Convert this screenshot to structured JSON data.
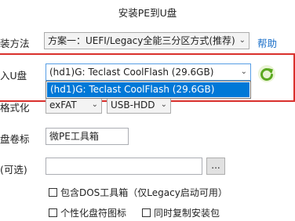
{
  "window": {
    "title": "安装PE到U盘"
  },
  "rows": {
    "install_method": {
      "label": "装方法",
      "value": "方案一：UEFI/Legacy全能三分区方式(推荐)",
      "help": "帮助"
    },
    "target_usb": {
      "label": "入U盘",
      "value": "(hd1)G: Teclast CoolFlash (29.6GB)",
      "options": [
        "(hd1)G: Teclast CoolFlash (29.6GB)"
      ]
    },
    "format": {
      "label": "格式化",
      "filesystem": "exFAT",
      "mode": "USB-HDD"
    },
    "volume_label": {
      "label": "盘卷标",
      "value": "微PE工具箱"
    },
    "optional": {
      "label": "(可选)",
      "value": "",
      "browse": "..."
    }
  },
  "options": {
    "dos_tools": "包含DOS工具箱（仅Legacy启动可用）",
    "personalize_icon": "个性化盘符图标",
    "copy_installer": "同时复制安装包"
  },
  "colors": {
    "highlight": "#0078d7",
    "annotation": "#d9302c",
    "link": "#1a6fc9"
  },
  "icons": {
    "refresh": "refresh-icon"
  }
}
